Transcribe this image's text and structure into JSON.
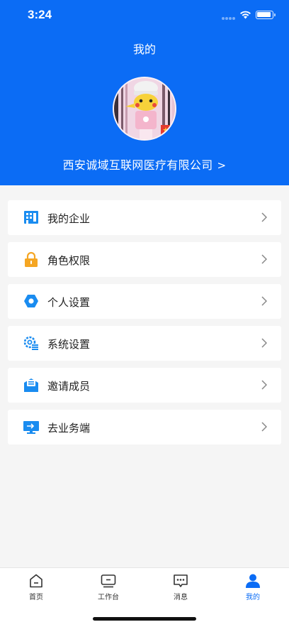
{
  "status_bar": {
    "time": "3:24"
  },
  "header": {
    "title": "我的",
    "company_name": "西安诚域互联网医疗有限公司",
    "company_chevron": ">"
  },
  "menu": {
    "items": [
      {
        "label": "我的企业",
        "icon": "building-icon",
        "color": "#1a8cf0"
      },
      {
        "label": "角色权限",
        "icon": "lock-icon",
        "color": "#f5a623"
      },
      {
        "label": "个人设置",
        "icon": "hexagon-settings-icon",
        "color": "#1a8cf0"
      },
      {
        "label": "系统设置",
        "icon": "gear-list-icon",
        "color": "#1a8cf0"
      },
      {
        "label": "邀请成员",
        "icon": "envelope-icon",
        "color": "#1a8cf0"
      },
      {
        "label": "去业务端",
        "icon": "monitor-icon",
        "color": "#1a8cf0"
      }
    ]
  },
  "tabbar": {
    "tabs": [
      {
        "label": "首页",
        "icon": "home-icon"
      },
      {
        "label": "工作台",
        "icon": "workbench-icon"
      },
      {
        "label": "消息",
        "icon": "message-icon"
      },
      {
        "label": "我的",
        "icon": "profile-icon",
        "active": true
      }
    ]
  },
  "colors": {
    "brand": "#0b6cf5",
    "background": "#f5f5f5"
  }
}
